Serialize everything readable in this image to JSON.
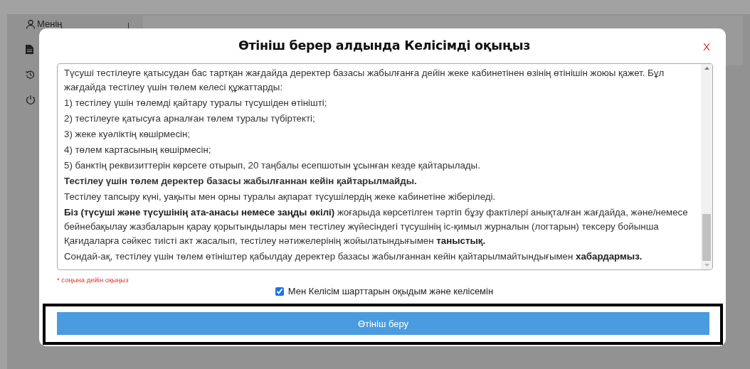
{
  "sidebar": {
    "profile_label": "Менің"
  },
  "modal": {
    "title": "Өтініш берер алдында Келісімді оқыңыз",
    "close": "X",
    "agreement": [
      {
        "text": "Түсуші тестілеуге қатысудан бас тартқан жағдайда деректер базасы жабылғанға дейін жеке кабинетінен өзінің өтінішін жоюы қажет. Бұл жағдайда тестілеу үшін төлем келесі құжаттарды:",
        "bold": false
      },
      {
        "text": "1) тестілеу үшін төлемді қайтару туралы түсушіден өтінішті;",
        "bold": false
      },
      {
        "text": "2) тестілеуге қатысуға арналған төлем туралы түбіртекті;",
        "bold": false
      },
      {
        "text": "3) жеке куәліктің көшірмесін;",
        "bold": false
      },
      {
        "text": "4) төлем картасының көшірмесін;",
        "bold": false
      },
      {
        "text": "5) банктің реквизиттерін көрсете отырып, 20 таңбалы есепшотын ұсынған кезде қайтарылады.",
        "bold": false
      },
      {
        "text": "Тестілеу үшін төлем деректер базасы жабылғаннан кейін қайтарылмайды.",
        "bold": true
      },
      {
        "text": "Тестілеу тапсыру күні, уақыты мен орны туралы ақпарат түсушілердің жеке кабинетіне жіберіледі.",
        "bold": false
      },
      {
        "text": "**Біз (түсуші және түсушінің ата-анасы немесе заңды өкілі)** жоғарыда көрсетілген тәртіп бұзу фактілері анықталған жағдайда, және/немесе бейнебақылау жазбаларын қарау қорытындылары мен тестілеу жүйесіндегі түсушінің іс-қимыл журналын (логтарын) тексеру бойынша Қағидаларға сәйкес тиісті акт жасалып, тестілеу нәтижелерінің жойылатындығымен **таныстық.**",
        "bold": false
      },
      {
        "text": "Сондай-ақ, тестілеу үшін төлем өтініштер қабылдау деректер базасы жабылғаннан кейін қайтарылмайтындығымен **хабардармыз.**",
        "bold": false
      }
    ],
    "note": "* соңына дейін оқыңыз",
    "consent": {
      "label": "Мен Келісім шарттарын оқыдым және келісемін",
      "checked": true
    },
    "submit_button": "Өтініш беру"
  }
}
